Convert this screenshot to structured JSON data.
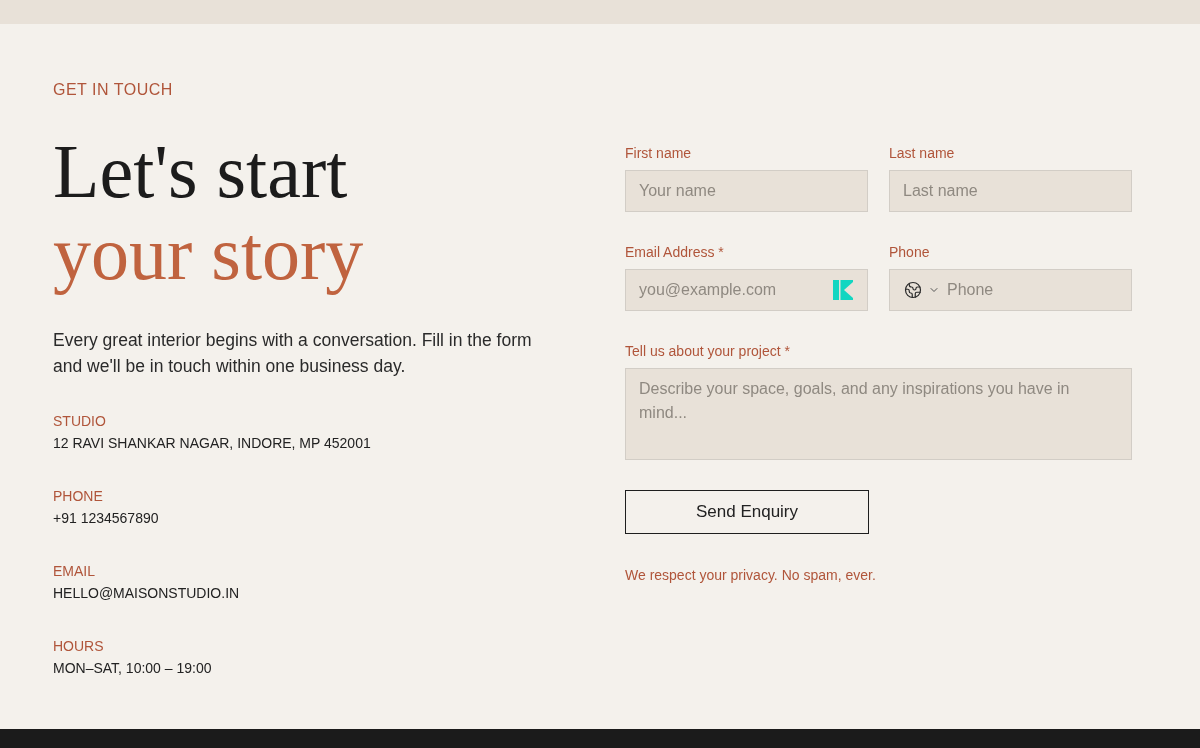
{
  "eyebrow": "GET IN TOUCH",
  "heading": {
    "line_1": "Let's start",
    "line_2": "your story"
  },
  "intro": "Every great interior begins with a conversation. Fill in the form and we'll be in touch within one business day.",
  "contact_details": [
    {
      "label": "STUDIO",
      "value": "12 RAVI SHANKAR NAGAR, INDORE, MP 452001"
    },
    {
      "label": "PHONE",
      "value": "+91 1234567890"
    },
    {
      "label": "EMAIL",
      "value": "HELLO@MAISONSTUDIO.IN"
    },
    {
      "label": "HOURS",
      "value": "MON–SAT, 10:00 – 19:00"
    }
  ],
  "form": {
    "fields": [
      {
        "kind": "text",
        "label": "First name",
        "placeholder": "Your name"
      },
      {
        "kind": "text",
        "label": "Last name",
        "placeholder": "Last name"
      },
      {
        "kind": "email",
        "label": "Email Address *",
        "placeholder": "you@example.com"
      },
      {
        "kind": "phone",
        "label": "Phone",
        "placeholder": "Phone"
      },
      {
        "kind": "textarea",
        "label": "Tell us about your project *",
        "placeholder": "Describe your space, goals, and any inspirations you have in mind..."
      }
    ],
    "submit": "Send Enquiry",
    "privacy_note": "We respect your privacy. No spam, ever."
  }
}
